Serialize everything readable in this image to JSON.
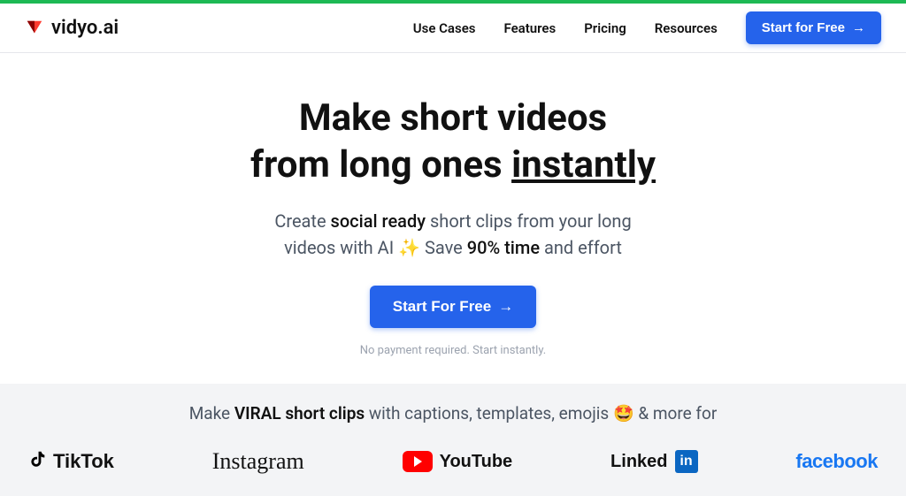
{
  "brand_name": "vidyo.ai",
  "nav": {
    "items": [
      "Use Cases",
      "Features",
      "Pricing",
      "Resources"
    ],
    "cta": "Start for Free"
  },
  "hero": {
    "headline_line1": "Make short videos",
    "headline_line2_prefix": "from long ones ",
    "headline_line2_underlined": "instantly",
    "sub_prefix": "Create ",
    "sub_strong1": "social ready",
    "sub_mid": " short clips from your long",
    "sub_line2_prefix": "videos with AI ",
    "sub_sparkle": "✨",
    "sub_line2_mid": " Save ",
    "sub_strong2": "90% time",
    "sub_line2_suffix": " and effort",
    "cta": "Start For Free",
    "fineprint": "No payment required. Start instantly."
  },
  "brands": {
    "tagline_prefix": "Make ",
    "tagline_strong": "VIRAL short clips",
    "tagline_mid": " with captions, templates, emojis ",
    "tagline_emoji": "🤩",
    "tagline_suffix": " & more for",
    "tiktok": "TikTok",
    "instagram": "Instagram",
    "youtube": "YouTube",
    "linkedin_text": "Linked",
    "linkedin_box": "in",
    "facebook": "facebook"
  }
}
